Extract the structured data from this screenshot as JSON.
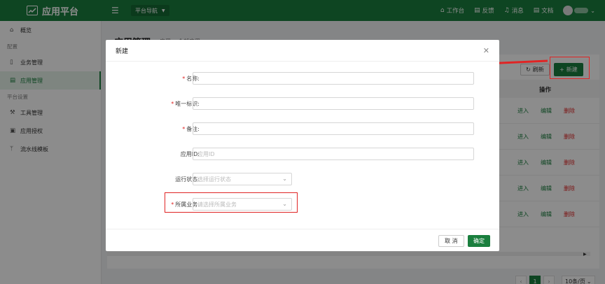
{
  "app": {
    "title": "应用平台"
  },
  "topbar": {
    "nav_label": "平台导航",
    "links": [
      {
        "icon": "home-icon",
        "label": "工作台"
      },
      {
        "icon": "feedback-icon",
        "label": "反馈"
      },
      {
        "icon": "bell-icon",
        "label": "消息"
      },
      {
        "icon": "doc-icon",
        "label": "文档"
      }
    ]
  },
  "sidebar": {
    "overview": "概览",
    "group_config": "配置",
    "business": "业务管理",
    "app_manage": "应用管理",
    "group_platform": "平台设置",
    "tool_manage": "工具管理",
    "app_auth": "应用授权",
    "pipeline_template": "流水线模板"
  },
  "main": {
    "page_title": "应用管理",
    "tabs": [
      "应用",
      "全部应用"
    ],
    "refresh_label": "刷新",
    "new_label": "新建",
    "column_action": "操作",
    "row_actions": {
      "enter": "进入",
      "edit": "编辑",
      "delete": "删除"
    },
    "row_count": 5,
    "pager": {
      "current": "1",
      "page_size": "10条/页"
    }
  },
  "modal": {
    "title": "新建",
    "fields": {
      "name": {
        "label": "名称:",
        "required": true,
        "placeholder": ""
      },
      "unique_id": {
        "label": "唯一标识:",
        "required": true,
        "placeholder": ""
      },
      "remark": {
        "label": "备注:",
        "required": true,
        "placeholder": ""
      },
      "app_id": {
        "label": "应用ID:",
        "required": false,
        "placeholder": "应用ID"
      },
      "run_status": {
        "label": "运行状态:",
        "required": false,
        "placeholder": "选择运行状态"
      },
      "business": {
        "label": "所属业务:",
        "required": true,
        "placeholder": "请选择所属业务"
      }
    },
    "cancel_label": "取 消",
    "ok_label": "确定"
  },
  "colors": {
    "brand": "#1a7f3e",
    "danger": "#e02424",
    "highlight": "#e02424"
  }
}
